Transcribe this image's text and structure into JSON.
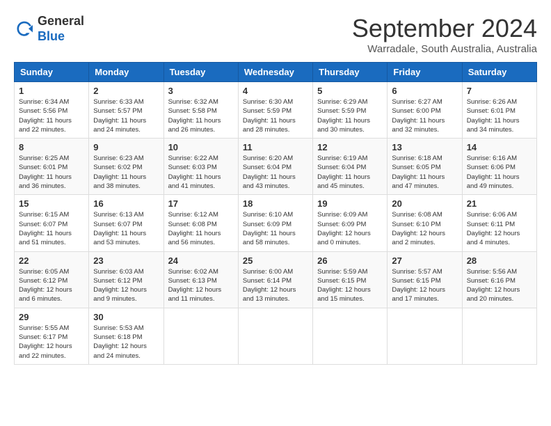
{
  "logo": {
    "general": "General",
    "blue": "Blue"
  },
  "title": "September 2024",
  "subtitle": "Warradale, South Australia, Australia",
  "headers": [
    "Sunday",
    "Monday",
    "Tuesday",
    "Wednesday",
    "Thursday",
    "Friday",
    "Saturday"
  ],
  "weeks": [
    [
      {
        "day": "1",
        "sunrise": "6:34 AM",
        "sunset": "5:56 PM",
        "daylight": "11 hours and 22 minutes."
      },
      {
        "day": "2",
        "sunrise": "6:33 AM",
        "sunset": "5:57 PM",
        "daylight": "11 hours and 24 minutes."
      },
      {
        "day": "3",
        "sunrise": "6:32 AM",
        "sunset": "5:58 PM",
        "daylight": "11 hours and 26 minutes."
      },
      {
        "day": "4",
        "sunrise": "6:30 AM",
        "sunset": "5:59 PM",
        "daylight": "11 hours and 28 minutes."
      },
      {
        "day": "5",
        "sunrise": "6:29 AM",
        "sunset": "5:59 PM",
        "daylight": "11 hours and 30 minutes."
      },
      {
        "day": "6",
        "sunrise": "6:27 AM",
        "sunset": "6:00 PM",
        "daylight": "11 hours and 32 minutes."
      },
      {
        "day": "7",
        "sunrise": "6:26 AM",
        "sunset": "6:01 PM",
        "daylight": "11 hours and 34 minutes."
      }
    ],
    [
      {
        "day": "8",
        "sunrise": "6:25 AM",
        "sunset": "6:01 PM",
        "daylight": "11 hours and 36 minutes."
      },
      {
        "day": "9",
        "sunrise": "6:23 AM",
        "sunset": "6:02 PM",
        "daylight": "11 hours and 38 minutes."
      },
      {
        "day": "10",
        "sunrise": "6:22 AM",
        "sunset": "6:03 PM",
        "daylight": "11 hours and 41 minutes."
      },
      {
        "day": "11",
        "sunrise": "6:20 AM",
        "sunset": "6:04 PM",
        "daylight": "11 hours and 43 minutes."
      },
      {
        "day": "12",
        "sunrise": "6:19 AM",
        "sunset": "6:04 PM",
        "daylight": "11 hours and 45 minutes."
      },
      {
        "day": "13",
        "sunrise": "6:18 AM",
        "sunset": "6:05 PM",
        "daylight": "11 hours and 47 minutes."
      },
      {
        "day": "14",
        "sunrise": "6:16 AM",
        "sunset": "6:06 PM",
        "daylight": "11 hours and 49 minutes."
      }
    ],
    [
      {
        "day": "15",
        "sunrise": "6:15 AM",
        "sunset": "6:07 PM",
        "daylight": "11 hours and 51 minutes."
      },
      {
        "day": "16",
        "sunrise": "6:13 AM",
        "sunset": "6:07 PM",
        "daylight": "11 hours and 53 minutes."
      },
      {
        "day": "17",
        "sunrise": "6:12 AM",
        "sunset": "6:08 PM",
        "daylight": "11 hours and 56 minutes."
      },
      {
        "day": "18",
        "sunrise": "6:10 AM",
        "sunset": "6:09 PM",
        "daylight": "11 hours and 58 minutes."
      },
      {
        "day": "19",
        "sunrise": "6:09 AM",
        "sunset": "6:09 PM",
        "daylight": "12 hours and 0 minutes."
      },
      {
        "day": "20",
        "sunrise": "6:08 AM",
        "sunset": "6:10 PM",
        "daylight": "12 hours and 2 minutes."
      },
      {
        "day": "21",
        "sunrise": "6:06 AM",
        "sunset": "6:11 PM",
        "daylight": "12 hours and 4 minutes."
      }
    ],
    [
      {
        "day": "22",
        "sunrise": "6:05 AM",
        "sunset": "6:12 PM",
        "daylight": "12 hours and 6 minutes."
      },
      {
        "day": "23",
        "sunrise": "6:03 AM",
        "sunset": "6:12 PM",
        "daylight": "12 hours and 9 minutes."
      },
      {
        "day": "24",
        "sunrise": "6:02 AM",
        "sunset": "6:13 PM",
        "daylight": "12 hours and 11 minutes."
      },
      {
        "day": "25",
        "sunrise": "6:00 AM",
        "sunset": "6:14 PM",
        "daylight": "12 hours and 13 minutes."
      },
      {
        "day": "26",
        "sunrise": "5:59 AM",
        "sunset": "6:15 PM",
        "daylight": "12 hours and 15 minutes."
      },
      {
        "day": "27",
        "sunrise": "5:57 AM",
        "sunset": "6:15 PM",
        "daylight": "12 hours and 17 minutes."
      },
      {
        "day": "28",
        "sunrise": "5:56 AM",
        "sunset": "6:16 PM",
        "daylight": "12 hours and 20 minutes."
      }
    ],
    [
      {
        "day": "29",
        "sunrise": "5:55 AM",
        "sunset": "6:17 PM",
        "daylight": "12 hours and 22 minutes."
      },
      {
        "day": "30",
        "sunrise": "5:53 AM",
        "sunset": "6:18 PM",
        "daylight": "12 hours and 24 minutes."
      },
      null,
      null,
      null,
      null,
      null
    ]
  ]
}
